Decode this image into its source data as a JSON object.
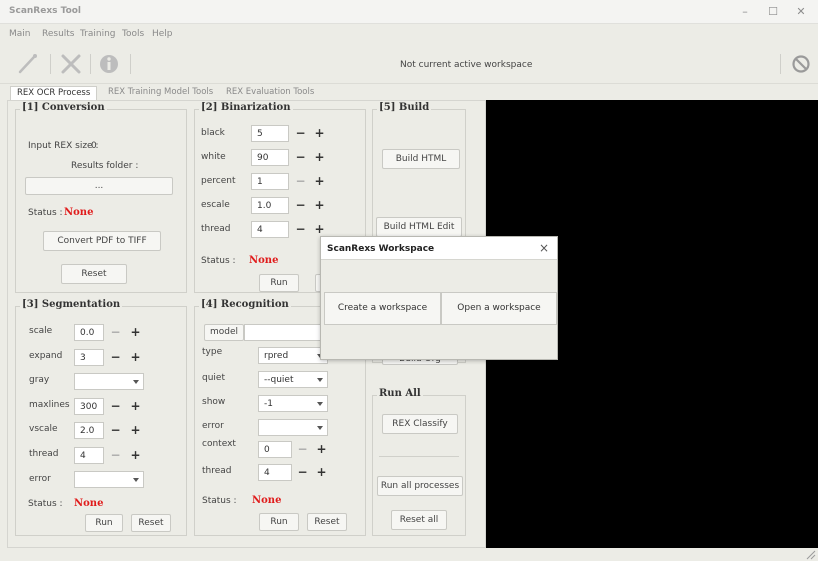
{
  "window": {
    "title": "ScanRexs Tool"
  },
  "menu": [
    "Main",
    "Results",
    "Training",
    "Tools",
    "Help"
  ],
  "toolbar": {
    "workspace_msg": "Not current active workspace"
  },
  "tabs": [
    "REX OCR Process",
    "REX Training Model Tools",
    "REX Evaluation Tools"
  ],
  "conversion": {
    "title": "[1] Conversion",
    "input_label": "Input REX size :",
    "input_value": "0",
    "results_label": "Results folder :",
    "browse_label": "...",
    "status_label": "Status :",
    "status_value": "None",
    "convert_label": "Convert PDF to TIFF",
    "reset_label": "Reset"
  },
  "binarization": {
    "title": "[2] Binarization",
    "rows": [
      {
        "label": "black",
        "value": "5"
      },
      {
        "label": "white",
        "value": "90"
      },
      {
        "label": "percent",
        "value": "1"
      },
      {
        "label": "escale",
        "value": "1.0"
      },
      {
        "label": "thread",
        "value": "4"
      }
    ],
    "status_label": "Status :",
    "status_value": "None",
    "run_label": "Run"
  },
  "build": {
    "title": "[5] Build",
    "build_html": "Build HTML",
    "build_html_edit": "Build HTML Edit",
    "build_org": "Build Org"
  },
  "segmentation": {
    "title": "[3] Segmentation",
    "rows": [
      {
        "label": "scale",
        "value": "0.0"
      },
      {
        "label": "expand",
        "value": "3"
      },
      {
        "label": "gray",
        "value": ""
      },
      {
        "label": "maxlines",
        "value": "300"
      },
      {
        "label": "vscale",
        "value": "2.0"
      },
      {
        "label": "thread",
        "value": "4"
      },
      {
        "label": "error",
        "value": ""
      }
    ],
    "status_label": "Status :",
    "status_value": "None",
    "run_label": "Run",
    "reset_label": "Reset"
  },
  "recognition": {
    "title": "[4] Recognition",
    "model_label": "model",
    "rows": [
      {
        "label": "type",
        "value": "rpred"
      },
      {
        "label": "quiet",
        "value": "--quiet"
      },
      {
        "label": "show",
        "value": "-1"
      },
      {
        "label": "error",
        "value": ""
      },
      {
        "label": "context",
        "value": "0"
      },
      {
        "label": "thread",
        "value": "4"
      }
    ],
    "status_label": "Status :",
    "status_value": "None",
    "run_label": "Run",
    "reset_label": "Reset"
  },
  "run_all": {
    "title": "Run All",
    "classify_label": "REX Classify",
    "run_all_label": "Run all processes",
    "reset_all_label": "Reset all"
  },
  "dialog": {
    "title": "ScanRexs Workspace",
    "create_label": "Create a workspace",
    "open_label": "Open a workspace"
  },
  "colors": {
    "status_red": "#e01b1b",
    "canvas": "#000000"
  }
}
